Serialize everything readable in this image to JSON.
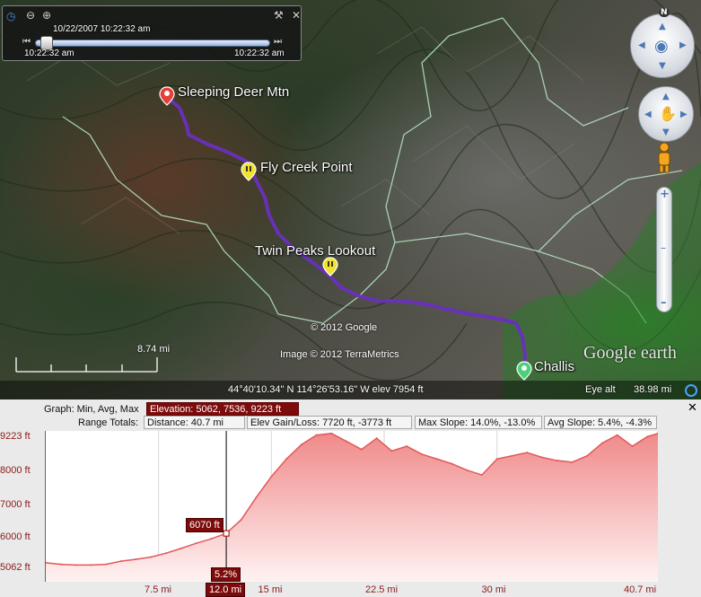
{
  "time_slider": {
    "date_time": "10/22/2007   10:22:32 am",
    "start_time": "10:22:32 am",
    "end_time": "10:22:32 am",
    "icons": [
      "clock-icon",
      "zoom-out-icon",
      "zoom-in-icon",
      "wrench-icon",
      "close-icon"
    ]
  },
  "map": {
    "placemarks": [
      {
        "label": "Sleeping Deer Mtn",
        "color": "#e4403a"
      },
      {
        "label": "Fly Creek Point",
        "color": "#f3e22a"
      },
      {
        "label": "Twin Peaks Lookout",
        "color": "#f3e22a"
      },
      {
        "label": "Challis",
        "color": "#4bd07a"
      }
    ],
    "copyright_1": "© 2012 Google",
    "copyright_2": "Image © 2012 TerraMetrics",
    "logo": "Google earth",
    "scale_label": "8.74 mi",
    "coordinates": "44°40'10.34\" N 114°26'53.16\" W elev  7954 ft",
    "eye_alt_label": "Eye alt",
    "eye_alt_value": "38.98 mi",
    "track_color": "#6a2fbf",
    "compass_north": "N"
  },
  "profile": {
    "graph_label": "Graph: Min, Avg, Max",
    "elevation": "Elevation: 5062, 7536, 9223 ft",
    "range_label": "Range Totals:",
    "distance": "Distance: 40.7 mi",
    "elev_gain_loss": "Elev Gain/Loss:  7720 ft, -3773 ft",
    "max_slope": "Max Slope: 14.0%, -13.0%",
    "avg_slope": "Avg Slope: 5.4%, -4.3%",
    "close_label": "✕",
    "cursor_elevation": "6070 ft",
    "cursor_slope": "5.2%",
    "cursor_distance": "12.0 mi"
  },
  "chart_data": {
    "type": "area",
    "ylabel": "",
    "xlabel": "",
    "y_ticks": [
      "9223 ft",
      "8000 ft",
      "7000 ft",
      "6000 ft",
      "5062 ft"
    ],
    "x_ticks": [
      "7.5 mi",
      "15 mi",
      "22.5 mi",
      "30 mi",
      "40.7 mi"
    ],
    "ylim": [
      5062,
      9223
    ],
    "xlim": [
      0,
      40.7
    ],
    "x": [
      0,
      1,
      2,
      3,
      4,
      5,
      6,
      7,
      8,
      9,
      10,
      11,
      12,
      13,
      14,
      15,
      16,
      17,
      18,
      19,
      20,
      21,
      22,
      23,
      24,
      25,
      26,
      27,
      28,
      29,
      30,
      31,
      32,
      33,
      34,
      35,
      36,
      37,
      38,
      39,
      40,
      40.7
    ],
    "values": [
      5150,
      5100,
      5080,
      5080,
      5100,
      5200,
      5260,
      5330,
      5450,
      5600,
      5760,
      5900,
      6070,
      6500,
      7200,
      7850,
      8400,
      8850,
      9150,
      9200,
      8950,
      8700,
      9050,
      8650,
      8800,
      8550,
      8400,
      8250,
      8050,
      7900,
      8400,
      8500,
      8600,
      8450,
      8350,
      8300,
      8500,
      8900,
      9150,
      8800,
      9100,
      9200
    ],
    "series_color": "#e2585a",
    "cursor": {
      "x": 12.0,
      "y": 6070,
      "slope": "5.2%"
    }
  }
}
